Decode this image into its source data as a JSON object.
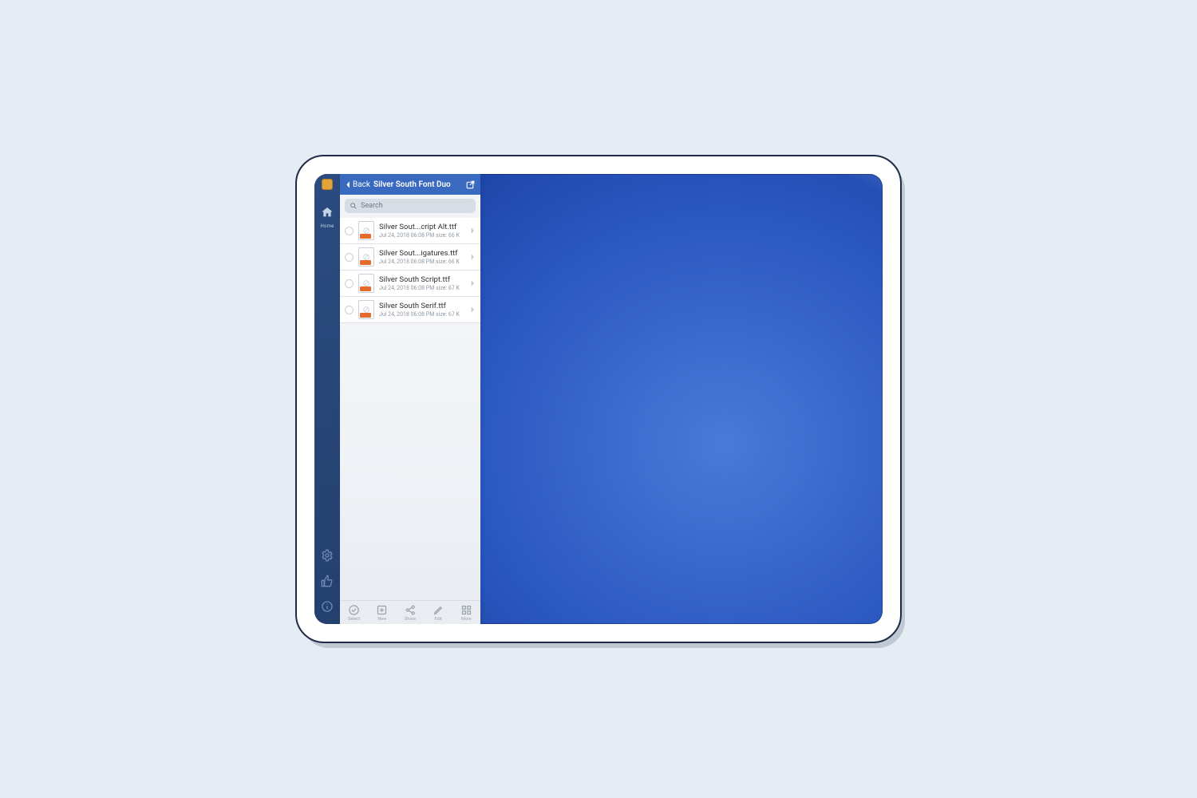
{
  "header": {
    "back_label": "Back",
    "title": "Silver South Font Duo"
  },
  "search": {
    "placeholder": "Search"
  },
  "rail": {
    "home_label": "Home"
  },
  "files": [
    {
      "name": "Silver Sout...cript Alt.ttf",
      "meta": "Jul 24, 2018 06:08 PM  size: 66 K"
    },
    {
      "name": "Silver Sout...igatures.ttf",
      "meta": "Jul 24, 2018 06:08 PM  size: 66 K"
    },
    {
      "name": "Silver South Script.ttf",
      "meta": "Jul 24, 2018 06:08 PM  size: 67 K"
    },
    {
      "name": "Silver South Serif.ttf",
      "meta": "Jul 24, 2018 06:08 PM  size: 67 K"
    }
  ],
  "toolbar": {
    "select": "Select",
    "new": "New",
    "share": "Share",
    "edit": "Edit",
    "more": "More"
  }
}
